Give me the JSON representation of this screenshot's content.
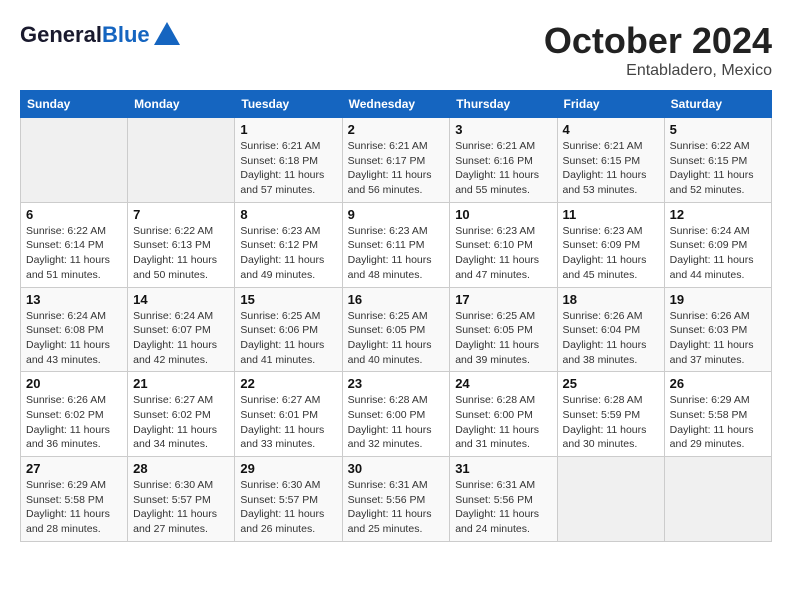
{
  "header": {
    "logo_line1": "General",
    "logo_line2": "Blue",
    "month": "October 2024",
    "location": "Entabladero, Mexico"
  },
  "days_of_week": [
    "Sunday",
    "Monday",
    "Tuesday",
    "Wednesday",
    "Thursday",
    "Friday",
    "Saturday"
  ],
  "weeks": [
    [
      {
        "day": "",
        "sunrise": "",
        "sunset": "",
        "daylight": ""
      },
      {
        "day": "",
        "sunrise": "",
        "sunset": "",
        "daylight": ""
      },
      {
        "day": "1",
        "sunrise": "Sunrise: 6:21 AM",
        "sunset": "Sunset: 6:18 PM",
        "daylight": "Daylight: 11 hours and 57 minutes."
      },
      {
        "day": "2",
        "sunrise": "Sunrise: 6:21 AM",
        "sunset": "Sunset: 6:17 PM",
        "daylight": "Daylight: 11 hours and 56 minutes."
      },
      {
        "day": "3",
        "sunrise": "Sunrise: 6:21 AM",
        "sunset": "Sunset: 6:16 PM",
        "daylight": "Daylight: 11 hours and 55 minutes."
      },
      {
        "day": "4",
        "sunrise": "Sunrise: 6:21 AM",
        "sunset": "Sunset: 6:15 PM",
        "daylight": "Daylight: 11 hours and 53 minutes."
      },
      {
        "day": "5",
        "sunrise": "Sunrise: 6:22 AM",
        "sunset": "Sunset: 6:15 PM",
        "daylight": "Daylight: 11 hours and 52 minutes."
      }
    ],
    [
      {
        "day": "6",
        "sunrise": "Sunrise: 6:22 AM",
        "sunset": "Sunset: 6:14 PM",
        "daylight": "Daylight: 11 hours and 51 minutes."
      },
      {
        "day": "7",
        "sunrise": "Sunrise: 6:22 AM",
        "sunset": "Sunset: 6:13 PM",
        "daylight": "Daylight: 11 hours and 50 minutes."
      },
      {
        "day": "8",
        "sunrise": "Sunrise: 6:23 AM",
        "sunset": "Sunset: 6:12 PM",
        "daylight": "Daylight: 11 hours and 49 minutes."
      },
      {
        "day": "9",
        "sunrise": "Sunrise: 6:23 AM",
        "sunset": "Sunset: 6:11 PM",
        "daylight": "Daylight: 11 hours and 48 minutes."
      },
      {
        "day": "10",
        "sunrise": "Sunrise: 6:23 AM",
        "sunset": "Sunset: 6:10 PM",
        "daylight": "Daylight: 11 hours and 47 minutes."
      },
      {
        "day": "11",
        "sunrise": "Sunrise: 6:23 AM",
        "sunset": "Sunset: 6:09 PM",
        "daylight": "Daylight: 11 hours and 45 minutes."
      },
      {
        "day": "12",
        "sunrise": "Sunrise: 6:24 AM",
        "sunset": "Sunset: 6:09 PM",
        "daylight": "Daylight: 11 hours and 44 minutes."
      }
    ],
    [
      {
        "day": "13",
        "sunrise": "Sunrise: 6:24 AM",
        "sunset": "Sunset: 6:08 PM",
        "daylight": "Daylight: 11 hours and 43 minutes."
      },
      {
        "day": "14",
        "sunrise": "Sunrise: 6:24 AM",
        "sunset": "Sunset: 6:07 PM",
        "daylight": "Daylight: 11 hours and 42 minutes."
      },
      {
        "day": "15",
        "sunrise": "Sunrise: 6:25 AM",
        "sunset": "Sunset: 6:06 PM",
        "daylight": "Daylight: 11 hours and 41 minutes."
      },
      {
        "day": "16",
        "sunrise": "Sunrise: 6:25 AM",
        "sunset": "Sunset: 6:05 PM",
        "daylight": "Daylight: 11 hours and 40 minutes."
      },
      {
        "day": "17",
        "sunrise": "Sunrise: 6:25 AM",
        "sunset": "Sunset: 6:05 PM",
        "daylight": "Daylight: 11 hours and 39 minutes."
      },
      {
        "day": "18",
        "sunrise": "Sunrise: 6:26 AM",
        "sunset": "Sunset: 6:04 PM",
        "daylight": "Daylight: 11 hours and 38 minutes."
      },
      {
        "day": "19",
        "sunrise": "Sunrise: 6:26 AM",
        "sunset": "Sunset: 6:03 PM",
        "daylight": "Daylight: 11 hours and 37 minutes."
      }
    ],
    [
      {
        "day": "20",
        "sunrise": "Sunrise: 6:26 AM",
        "sunset": "Sunset: 6:02 PM",
        "daylight": "Daylight: 11 hours and 36 minutes."
      },
      {
        "day": "21",
        "sunrise": "Sunrise: 6:27 AM",
        "sunset": "Sunset: 6:02 PM",
        "daylight": "Daylight: 11 hours and 34 minutes."
      },
      {
        "day": "22",
        "sunrise": "Sunrise: 6:27 AM",
        "sunset": "Sunset: 6:01 PM",
        "daylight": "Daylight: 11 hours and 33 minutes."
      },
      {
        "day": "23",
        "sunrise": "Sunrise: 6:28 AM",
        "sunset": "Sunset: 6:00 PM",
        "daylight": "Daylight: 11 hours and 32 minutes."
      },
      {
        "day": "24",
        "sunrise": "Sunrise: 6:28 AM",
        "sunset": "Sunset: 6:00 PM",
        "daylight": "Daylight: 11 hours and 31 minutes."
      },
      {
        "day": "25",
        "sunrise": "Sunrise: 6:28 AM",
        "sunset": "Sunset: 5:59 PM",
        "daylight": "Daylight: 11 hours and 30 minutes."
      },
      {
        "day": "26",
        "sunrise": "Sunrise: 6:29 AM",
        "sunset": "Sunset: 5:58 PM",
        "daylight": "Daylight: 11 hours and 29 minutes."
      }
    ],
    [
      {
        "day": "27",
        "sunrise": "Sunrise: 6:29 AM",
        "sunset": "Sunset: 5:58 PM",
        "daylight": "Daylight: 11 hours and 28 minutes."
      },
      {
        "day": "28",
        "sunrise": "Sunrise: 6:30 AM",
        "sunset": "Sunset: 5:57 PM",
        "daylight": "Daylight: 11 hours and 27 minutes."
      },
      {
        "day": "29",
        "sunrise": "Sunrise: 6:30 AM",
        "sunset": "Sunset: 5:57 PM",
        "daylight": "Daylight: 11 hours and 26 minutes."
      },
      {
        "day": "30",
        "sunrise": "Sunrise: 6:31 AM",
        "sunset": "Sunset: 5:56 PM",
        "daylight": "Daylight: 11 hours and 25 minutes."
      },
      {
        "day": "31",
        "sunrise": "Sunrise: 6:31 AM",
        "sunset": "Sunset: 5:56 PM",
        "daylight": "Daylight: 11 hours and 24 minutes."
      },
      {
        "day": "",
        "sunrise": "",
        "sunset": "",
        "daylight": ""
      },
      {
        "day": "",
        "sunrise": "",
        "sunset": "",
        "daylight": ""
      }
    ]
  ]
}
